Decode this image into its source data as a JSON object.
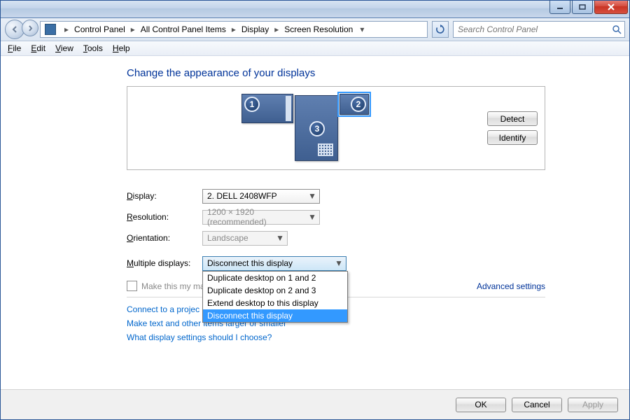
{
  "titlebar": {
    "minimize": "minimize",
    "maximize": "maximize",
    "close": "close"
  },
  "breadcrumb": {
    "items": [
      "Control Panel",
      "All Control Panel Items",
      "Display",
      "Screen Resolution"
    ]
  },
  "search": {
    "placeholder": "Search Control Panel"
  },
  "menu": {
    "file": "File",
    "edit": "Edit",
    "view": "View",
    "tools": "Tools",
    "help": "Help"
  },
  "heading": "Change the appearance of your displays",
  "monitor_buttons": {
    "detect": "Detect",
    "identify": "Identify"
  },
  "monitors": {
    "m1": "1",
    "m2": "2",
    "m3": "3"
  },
  "labels": {
    "display": "Display:",
    "resolution": "Resolution:",
    "orientation": "Orientation:",
    "multiple": "Multiple displays:",
    "make_main_full": "Make this my main display",
    "make_main_visible": "Make this my ma",
    "advanced": "Advanced settings"
  },
  "values": {
    "display": "2. DELL 2408WFP",
    "resolution": "1200 × 1920 (recommended)",
    "orientation": "Landscape",
    "multiple": "Disconnect this display"
  },
  "multiple_options": [
    "Duplicate desktop on 1 and 2",
    "Duplicate desktop on 2 and 3",
    "Extend desktop to this display",
    "Disconnect this display"
  ],
  "multiple_selected_index": 3,
  "links": {
    "projector_full": "Connect to a projector (or press the ⊞ key and tap P)",
    "projector_visible": "Connect to a projec",
    "text_size": "Make text and other items larger or smaller",
    "what": "What display settings should I choose?"
  },
  "footer": {
    "ok": "OK",
    "cancel": "Cancel",
    "apply": "Apply"
  }
}
